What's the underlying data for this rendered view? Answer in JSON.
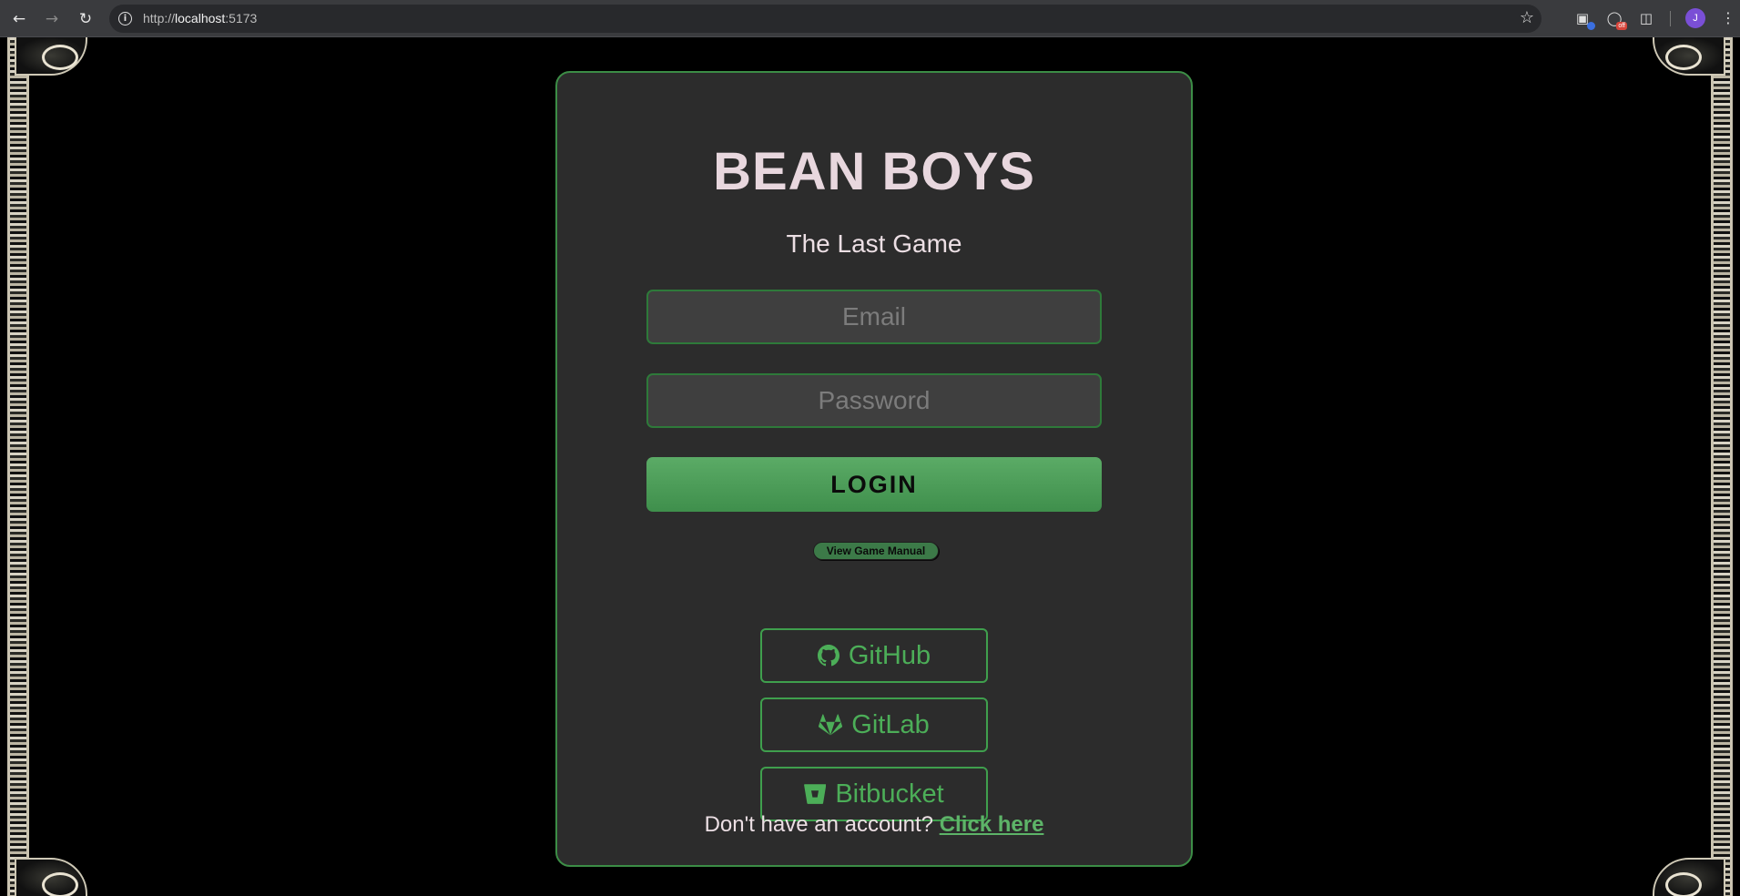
{
  "browser": {
    "url_scheme": "http://",
    "url_host": "localhost",
    "url_port": ":5173",
    "avatar_initial": "J",
    "extension_badge": "off"
  },
  "login": {
    "title": "BEAN BOYS",
    "subtitle": "The Last Game",
    "email_placeholder": "Email",
    "password_placeholder": "Password",
    "login_label": "LOGIN",
    "manual_label": "View Game Manual",
    "oauth": {
      "github": "GitHub",
      "gitlab": "GitLab",
      "bitbucket": "Bitbucket"
    },
    "signup_prompt": "Don't have an account?",
    "signup_link": "Click here"
  },
  "colors": {
    "accent_green": "#4cae58",
    "card_bg": "#2c2c2c",
    "title_pink": "#e8d7de"
  }
}
